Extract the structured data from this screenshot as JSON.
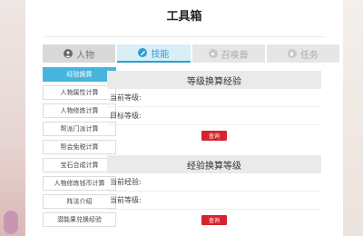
{
  "page": {
    "title": "工具箱"
  },
  "tabs": [
    {
      "label": "人物",
      "icon": "person-icon",
      "state": "normal"
    },
    {
      "label": "技能",
      "icon": "pencil-icon",
      "state": "active"
    },
    {
      "label": "召唤兽",
      "icon": "summon-icon",
      "state": "disabled"
    },
    {
      "label": "任务",
      "icon": "quest-icon",
      "state": "disabled"
    }
  ],
  "sidebar": {
    "items": [
      {
        "label": "经验换算"
      },
      {
        "label": "人物属性计算"
      },
      {
        "label": "人物修炼计算"
      },
      {
        "label": "帮派门派计算"
      },
      {
        "label": "帮会免税计算"
      },
      {
        "label": "宝石合成计算"
      },
      {
        "label": "人物修炼钱币计算"
      },
      {
        "label": "阵法介绍"
      },
      {
        "label": "潜能果兑换经验"
      }
    ]
  },
  "sections": [
    {
      "header": "等级换算经验",
      "field1_label": "当前等级:",
      "field2_label": "目标等级:",
      "button_label": "查询"
    },
    {
      "header": "经验换算等级",
      "field1_label": "当前经验:",
      "field2_label": "当前等级:",
      "button_label": "查询"
    }
  ],
  "colors": {
    "accent": "#2aa0cf",
    "sidebar_active": "#46b6df",
    "button": "#d7232d"
  }
}
